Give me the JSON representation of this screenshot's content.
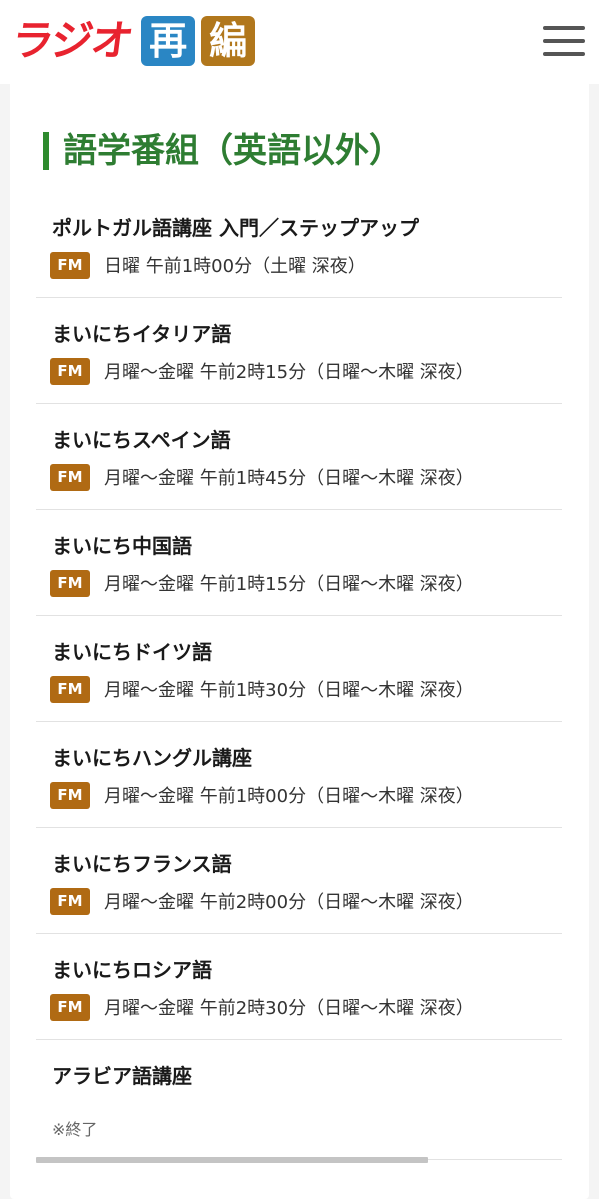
{
  "header": {
    "logo_text": "ラジオ",
    "logo_box_1": "再",
    "logo_box_2": "編"
  },
  "section": {
    "title": "語学番組（英語以外）"
  },
  "programs": [
    {
      "name": "ポルトガル語講座 入門／ステップアップ",
      "badge": "FM",
      "schedule": "日曜 午前1時00分（土曜 深夜）"
    },
    {
      "name": "まいにちイタリア語",
      "badge": "FM",
      "schedule": "月曜～金曜 午前2時15分（日曜～木曜 深夜）"
    },
    {
      "name": "まいにちスペイン語",
      "badge": "FM",
      "schedule": "月曜～金曜 午前1時45分（日曜～木曜 深夜）"
    },
    {
      "name": "まいにち中国語",
      "badge": "FM",
      "schedule": "月曜～金曜 午前1時15分（日曜～木曜 深夜）"
    },
    {
      "name": "まいにちドイツ語",
      "badge": "FM",
      "schedule": "月曜～金曜 午前1時30分（日曜～木曜 深夜）"
    },
    {
      "name": "まいにちハングル講座",
      "badge": "FM",
      "schedule": "月曜～金曜 午前1時00分（日曜～木曜 深夜）"
    },
    {
      "name": "まいにちフランス語",
      "badge": "FM",
      "schedule": "月曜～金曜 午前2時00分（日曜～木曜 深夜）"
    },
    {
      "name": "まいにちロシア語",
      "badge": "FM",
      "schedule": "月曜～金曜 午前2時30分（日曜～木曜 深夜）"
    },
    {
      "name": "アラビア語講座",
      "note": "※終了"
    }
  ],
  "icons": {
    "menu": "hamburger-menu-icon"
  },
  "colors": {
    "logo_red": "#e8232f",
    "logo_blue": "#2a86c4",
    "logo_brown": "#b1771c",
    "title_green": "#2e7d32",
    "badge_brown": "#b06a13"
  }
}
